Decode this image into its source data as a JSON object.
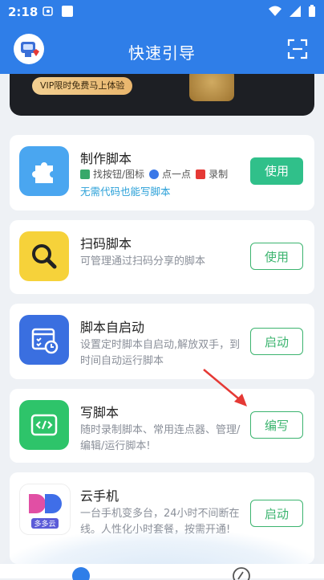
{
  "status_bar": {
    "time": "2:18"
  },
  "header": {
    "title": "快速引导"
  },
  "banner": {
    "promo": "VIP限时免费马上体验"
  },
  "cards": [
    {
      "name": "制作脚本",
      "tools": [
        "找按钮/图标",
        "点一点",
        "录制"
      ],
      "subtitle": "无需代码也能写脚本",
      "button": "使用",
      "icon": "puzzle-icon"
    },
    {
      "name": "扫码脚本",
      "desc": "可管理通过扫码分享的脚本",
      "button": "使用",
      "icon": "magnifier-icon"
    },
    {
      "name": "脚本自启动",
      "desc": "设置定时脚本自启动,解放双手，到时间自动运行脚本",
      "button": "启动",
      "icon": "calendar-clock-icon"
    },
    {
      "name": "写脚本",
      "desc": "随时录制脚本、常用连点器、管理/编辑/运行脚本!",
      "button": "编写",
      "icon": "code-icon"
    },
    {
      "name": "云手机",
      "desc": "一台手机变多台，24小时不间断在线。人性化小时套餐，按需开通!",
      "button": "启动",
      "icon": "duoduoyun-logo",
      "logo_text": "多多云"
    }
  ],
  "colors": {
    "brand_blue": "#2f7ee8",
    "green_button": "#30c08a",
    "outline_green": "#3cb46f",
    "arrow_red": "#e53935"
  }
}
